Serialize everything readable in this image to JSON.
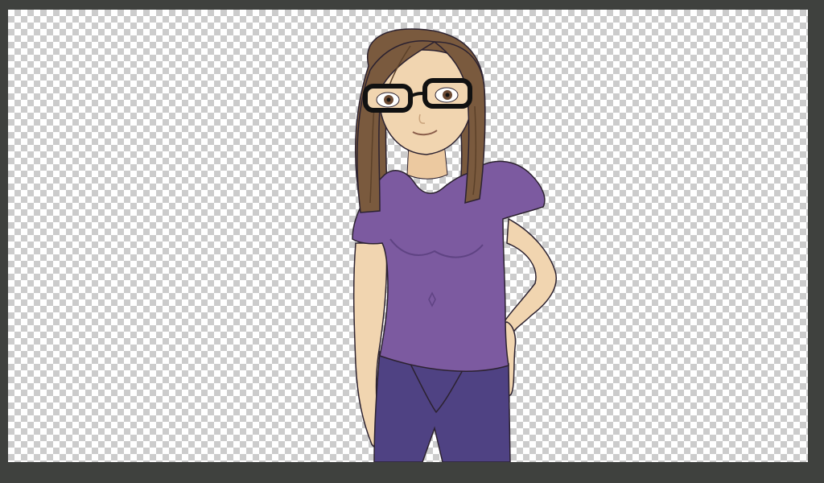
{
  "window": {
    "title": ""
  },
  "canvas": {
    "transparency_pattern": "checkerboard",
    "colors": {
      "workspace": "#3f413e",
      "checker_light": "#ffffff",
      "checker_dark": "#cccccc"
    }
  },
  "layer": {
    "content": "cartoon-woman",
    "colors": {
      "hair": "#7a5a3e",
      "hair_shadow": "#5c4129",
      "skin": "#f1d5b0",
      "shirt": "#7c5aa0",
      "shirt_dark": "#5f4383",
      "pants": "#4f4283",
      "outline": "#2c2230",
      "glasses": "#111111"
    }
  }
}
